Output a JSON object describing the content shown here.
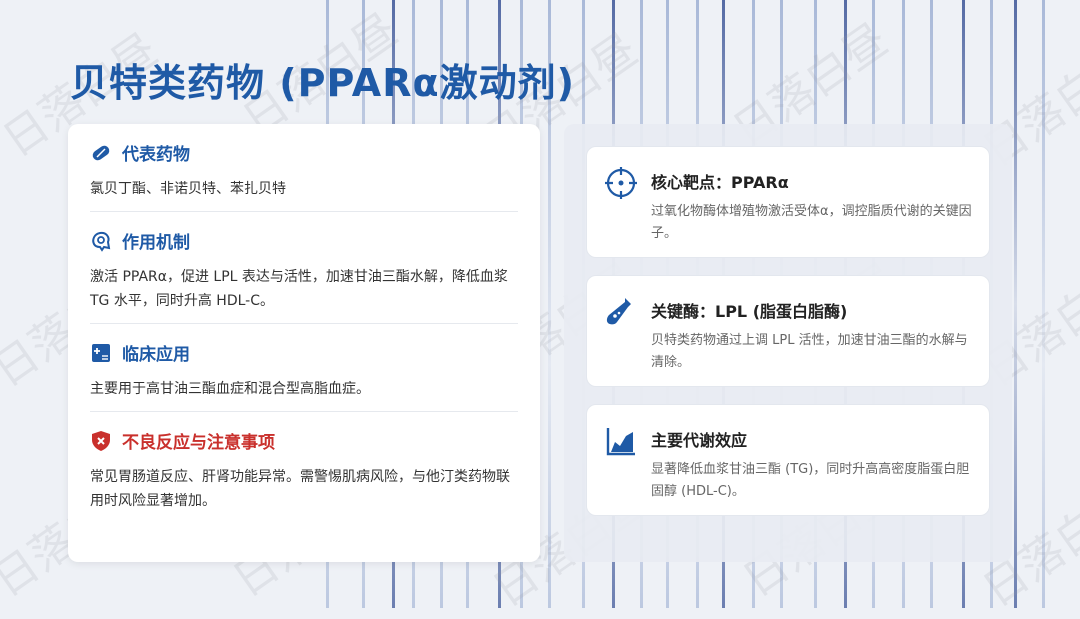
{
  "title": "贝特类药物 (PPARα激动剂)",
  "watermark": "日落白昼",
  "left": {
    "sections": [
      {
        "title": "代表药物",
        "text": "氯贝丁酯、非诺贝特、苯扎贝特",
        "icon": "pill-icon"
      },
      {
        "title": "作用机制",
        "text": "激活 PPARα，促进 LPL 表达与活性，加速甘油三酯水解，降低血浆 TG 水平，同时升高 HDL-C。",
        "icon": "brain-gear-icon"
      },
      {
        "title": "临床应用",
        "text": "主要用于高甘油三酯血症和混合型高脂血症。",
        "icon": "medical-file-icon"
      },
      {
        "title": "不良反应与注意事项",
        "text": "常见胃肠道反应、肝肾功能异常。需警惕肌病风险，与他汀类药物联用时风险显著增加。",
        "icon": "shield-alert-icon"
      }
    ]
  },
  "right": {
    "cards": [
      {
        "title": "核心靶点：PPARα",
        "text": "过氧化物酶体增殖物激活受体α，调控脂质代谢的关键因子。",
        "icon": "crosshair-icon"
      },
      {
        "title": "关键酶：LPL (脂蛋白脂酶)",
        "text": "贝特类药物通过上调 LPL 活性，加速甘油三酯的水解与清除。",
        "icon": "flask-icon"
      },
      {
        "title": "主要代谢效应",
        "text": "显著降低血浆甘油三酯 (TG)，同时升高高密度脂蛋白胆固醇 (HDL-C)。",
        "icon": "area-chart-icon"
      }
    ]
  },
  "colors": {
    "accent": "#1f5aa6",
    "warning": "#c9302c"
  }
}
